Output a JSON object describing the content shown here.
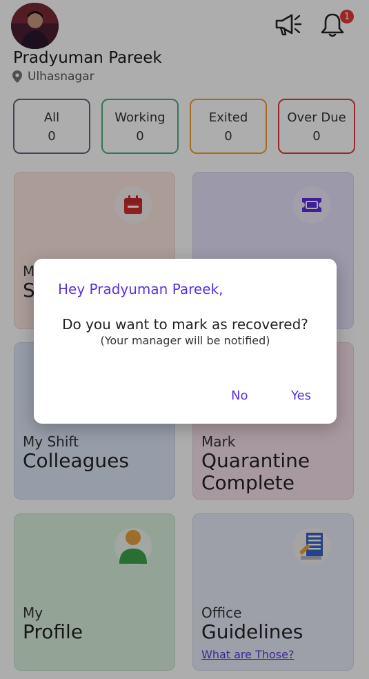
{
  "profile": {
    "name": "Pradyuman Pareek",
    "location": "Ulhasnagar"
  },
  "notifications": {
    "count": "1"
  },
  "stats": [
    {
      "label": "All",
      "value": "0",
      "color": "#5a6b7d"
    },
    {
      "label": "Working",
      "value": "0",
      "color": "#4caf7a"
    },
    {
      "label": "Exited",
      "value": "0",
      "color": "#f0a030"
    },
    {
      "label": "Over Due",
      "value": "0",
      "color": "#d84040"
    }
  ],
  "cards": {
    "schedule": {
      "small": "M",
      "big": "S"
    },
    "colleagues": {
      "small": "My Shift",
      "big": "Colleagues"
    },
    "quarantine": {
      "small": "Mark",
      "big1": "Quarantine",
      "big2": "Complete"
    },
    "profile": {
      "small": "My",
      "big": "Profile"
    },
    "guidelines": {
      "small": "Office",
      "big": "Guidelines",
      "link": "What are Those?"
    }
  },
  "dialog": {
    "greeting": "Hey Pradyuman Pareek,",
    "question": "Do you want to mark as recovered?",
    "note": "(Your manager will be notified)",
    "no_label": "No",
    "yes_label": "Yes"
  },
  "icons": {
    "calendar": "calendar-icon",
    "ticket": "ticket-icon",
    "megaphone": "megaphone-icon",
    "bell": "bell-icon",
    "location": "location-pin-icon",
    "person": "person-icon",
    "document": "document-icon"
  },
  "colors": {
    "accent": "#5b2ee0",
    "card_schedule": "#fde6e0",
    "card_ticket": "#e6e2fb",
    "card_colleagues": "#dde6f8",
    "card_quarantine": "#f8e0ea",
    "card_profile": "#d9f2df",
    "card_guidelines": "#e8ecf8"
  }
}
